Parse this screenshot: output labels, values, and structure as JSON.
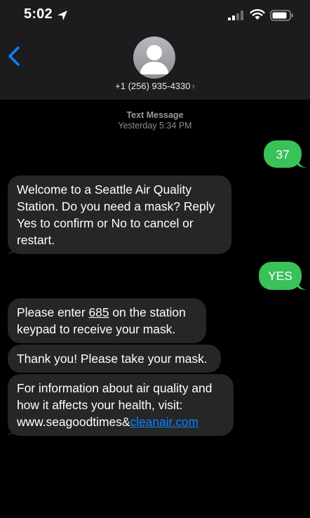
{
  "status_bar": {
    "time": "5:02"
  },
  "header": {
    "contact": "+1 (256) 935-4330",
    "chevron": "›"
  },
  "thread_meta": {
    "type": "Text Message",
    "time": "Yesterday 5:34 PM"
  },
  "messages": {
    "m1": {
      "direction": "outgoing",
      "text": "37"
    },
    "m2": {
      "direction": "incoming",
      "lines": [
        "Welcome to a Seattle Air Quality",
        "Station. Do you need a mask? Reply",
        "Yes to confirm or No to cancel or",
        "restart."
      ]
    },
    "m3": {
      "direction": "outgoing",
      "text": "YES"
    },
    "m4": {
      "direction": "incoming",
      "pre": "Please enter ",
      "code": "685",
      "post": " on the station",
      "line2": "keypad to receive your mask."
    },
    "m5": {
      "direction": "incoming",
      "text": "Thank you! Please take your mask."
    },
    "m6": {
      "direction": "incoming",
      "line1": "For information about air quality and",
      "line2": "how it affects your health, visit:",
      "line3_plain": "www.seagoodtimes&",
      "line3_link": "cleanair.com"
    }
  },
  "colors": {
    "outgoing_bubble": "#39c15a",
    "incoming_bubble": "#262628",
    "link": "#0a84ff",
    "header_bg": "#1c1c1e",
    "back_arrow": "#0a84ff"
  }
}
